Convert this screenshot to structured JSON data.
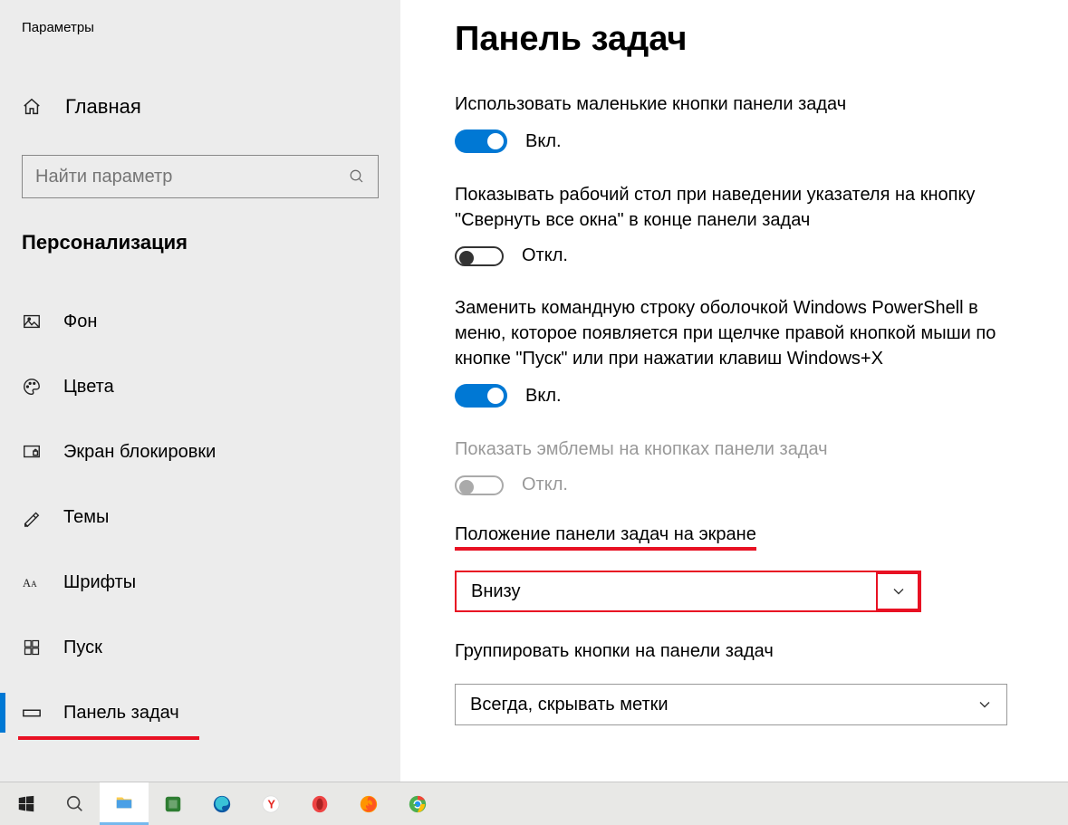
{
  "window": {
    "title": "Параметры"
  },
  "sidebar": {
    "home_label": "Главная",
    "search_placeholder": "Найти параметр",
    "category": "Персонализация",
    "items": [
      {
        "label": "Фон"
      },
      {
        "label": "Цвета"
      },
      {
        "label": "Экран блокировки"
      },
      {
        "label": "Темы"
      },
      {
        "label": "Шрифты"
      },
      {
        "label": "Пуск"
      },
      {
        "label": "Панель задач"
      }
    ]
  },
  "page": {
    "title": "Панель задач",
    "settings": [
      {
        "label": "Использовать маленькие кнопки панели задач",
        "state": "Вкл."
      },
      {
        "label": "Показывать рабочий стол при наведении указателя на кнопку \"Свернуть все окна\" в конце панели задач",
        "state": "Откл."
      },
      {
        "label": "Заменить командную строку оболочкой Windows PowerShell в меню, которое появляется при щелчке правой кнопкой мыши по кнопке \"Пуск\" или при нажатии клавиш Windows+X",
        "state": "Вкл."
      },
      {
        "label": "Показать эмблемы на кнопках панели задач",
        "state": "Откл."
      }
    ],
    "position": {
      "heading": "Положение панели задач на экране",
      "value": "Внизу"
    },
    "grouping": {
      "heading": "Группировать кнопки на панели задач",
      "value": "Всегда, скрывать метки"
    }
  }
}
